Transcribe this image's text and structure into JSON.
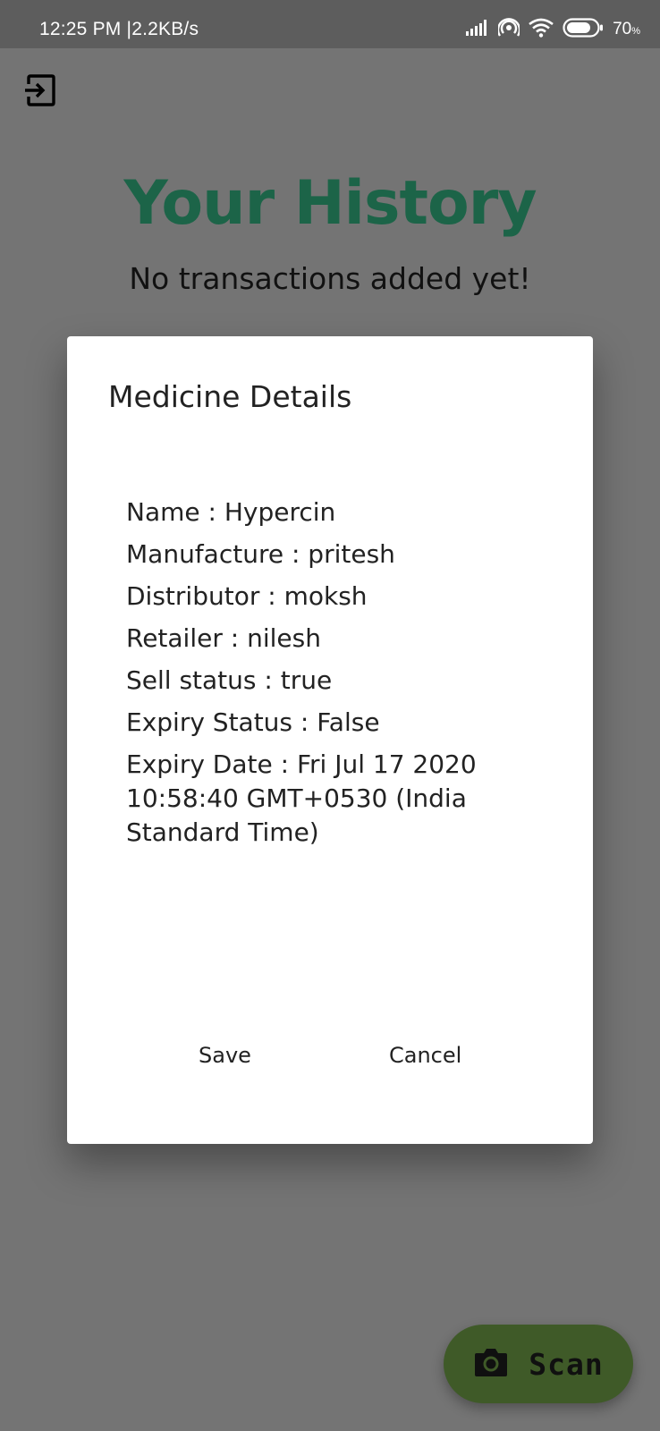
{
  "status_bar": {
    "time": "12:25 PM",
    "separator": "|",
    "speed": "2.2KB/s",
    "battery": "70",
    "battery_unit": "%",
    "icons": [
      "signal-icon",
      "hotspot-icon",
      "wifi-icon",
      "battery-icon"
    ]
  },
  "header": {
    "exit_icon": "exit-to-app-icon"
  },
  "page": {
    "title": "Your History",
    "subtitle": "No transactions added yet!",
    "title_color": "#1c6448"
  },
  "dialog": {
    "title": "Medicine Details",
    "details": [
      "Name : Hypercin",
      "Manufacture : pritesh",
      "Distributor : moksh",
      "Retailer : nilesh",
      "Sell status : true",
      "Expiry Status : False",
      "Expiry Date : Fri Jul 17 2020 10:58:40 GMT+0530 (India Standard Time)"
    ],
    "save_label": "Save",
    "cancel_label": "Cancel"
  },
  "fab": {
    "label": "Scan",
    "icon": "camera-icon",
    "color": "#3f5a28"
  }
}
